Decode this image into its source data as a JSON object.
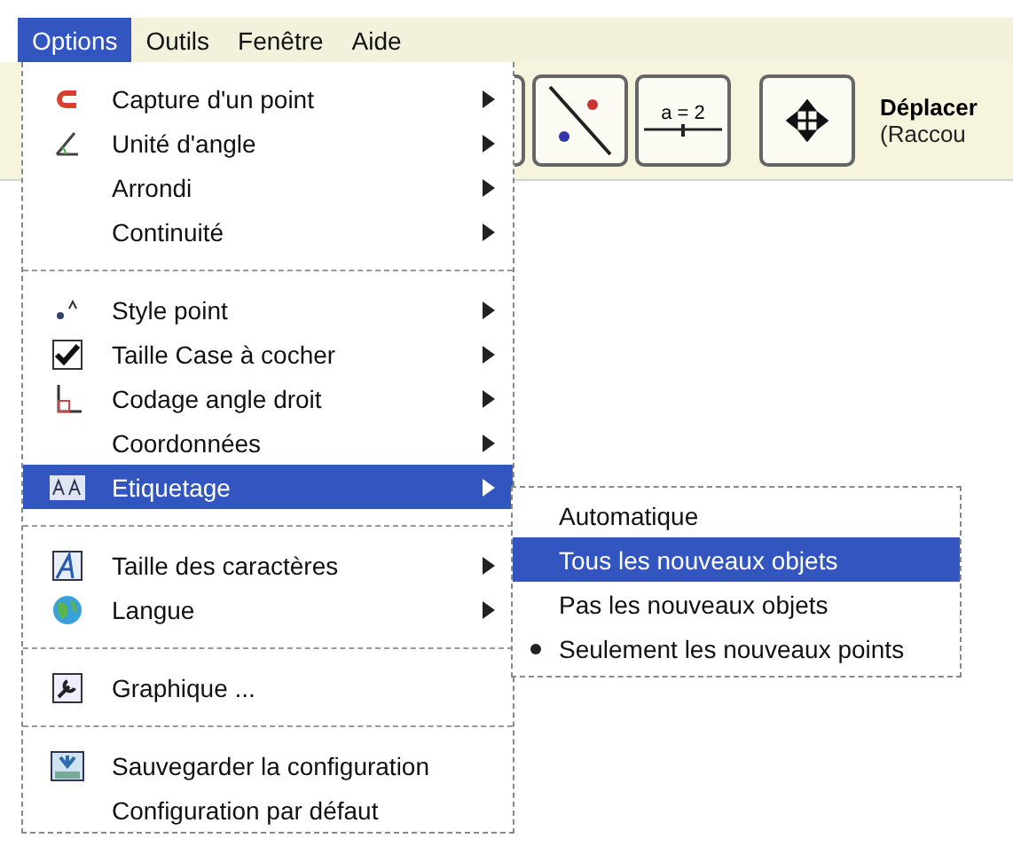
{
  "menubar": [
    {
      "label": "Options",
      "selected": true
    },
    {
      "label": "Outils",
      "selected": false
    },
    {
      "label": "Fenêtre",
      "selected": false
    },
    {
      "label": "Aide",
      "selected": false
    }
  ],
  "toolbar": {
    "tools": [
      {
        "kind": "partial"
      },
      {
        "kind": "line-points"
      },
      {
        "kind": "slider",
        "label": "a = 2"
      },
      {
        "kind": "move"
      }
    ],
    "tool_name": "Déplacer",
    "tool_hint": "(Raccou"
  },
  "menu": [
    {
      "kind": "item",
      "label": "Capture d'un point",
      "submenu": true,
      "selected": false
    },
    {
      "kind": "item",
      "label": "Unité d'angle",
      "submenu": true,
      "selected": false
    },
    {
      "kind": "item",
      "label": "Arrondi",
      "submenu": true,
      "selected": false
    },
    {
      "kind": "item",
      "label": "Continuité",
      "submenu": true,
      "selected": false
    },
    {
      "kind": "separator"
    },
    {
      "kind": "item",
      "label": "Style point",
      "submenu": true,
      "selected": false
    },
    {
      "kind": "item",
      "label": "Taille Case à cocher",
      "submenu": true,
      "selected": false
    },
    {
      "kind": "item",
      "label": "Codage angle droit",
      "submenu": true,
      "selected": false
    },
    {
      "kind": "item",
      "label": "Coordonnées",
      "submenu": true,
      "selected": false
    },
    {
      "kind": "item",
      "label": "Etiquetage",
      "submenu": true,
      "selected": true
    },
    {
      "kind": "separator"
    },
    {
      "kind": "item",
      "label": "Taille des caractères",
      "submenu": true,
      "selected": false
    },
    {
      "kind": "item",
      "label": "Langue",
      "submenu": true,
      "selected": false
    },
    {
      "kind": "separator"
    },
    {
      "kind": "item",
      "label": "Graphique ...",
      "submenu": false,
      "selected": false
    },
    {
      "kind": "separator"
    },
    {
      "kind": "item",
      "label": "Sauvegarder la configuration",
      "submenu": false,
      "selected": false
    },
    {
      "kind": "item",
      "label": "Configuration par défaut",
      "submenu": false,
      "selected": false
    }
  ],
  "submenu": [
    {
      "label": "Automatique",
      "selected": false,
      "checked": false
    },
    {
      "label": "Tous les nouveaux objets",
      "selected": true,
      "checked": false
    },
    {
      "label": "Pas les nouveaux objets",
      "selected": false,
      "checked": false
    },
    {
      "label": "Seulement les nouveaux points",
      "selected": false,
      "checked": true
    }
  ]
}
